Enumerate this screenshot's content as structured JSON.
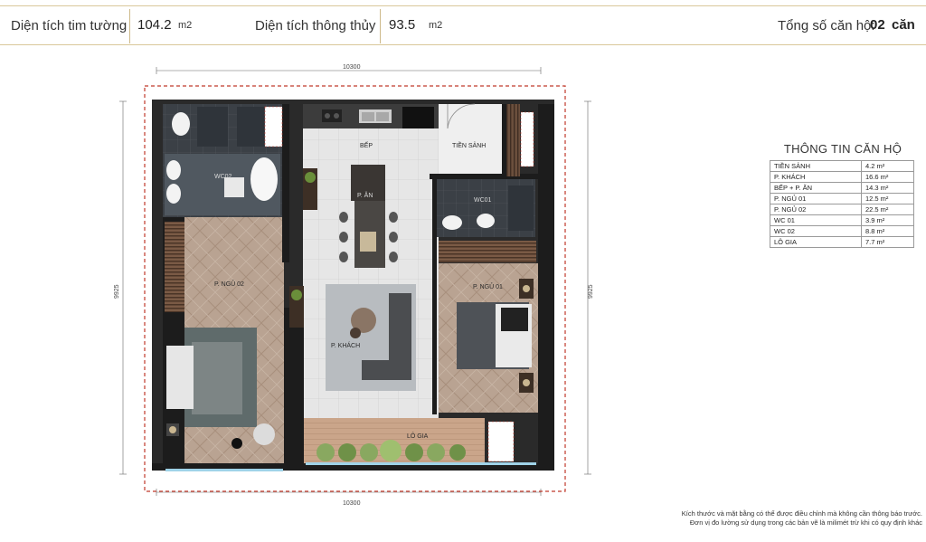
{
  "header": {
    "wall_area_label": "Diện tích tim tường",
    "wall_area_value": "104.2",
    "wall_area_unit": "m2",
    "clear_area_label": "Diện tích thông thủy",
    "clear_area_value": "93.5",
    "clear_area_unit": "m2",
    "unit_count_label": "Tổng số căn hộ:",
    "unit_count_value": "02",
    "unit_count_unit": "căn"
  },
  "plan": {
    "dim_top": "10300",
    "dim_bottom": "10300",
    "dim_left": "9925",
    "dim_right": "9925",
    "rooms": {
      "kitchen": "BẾP",
      "foyer": "TIỀN SẢNH",
      "wc02": "WC02",
      "wc01": "WC01",
      "dining": "P. ĂN",
      "bed02": "P. NGỦ 02",
      "bed01": "P. NGỦ 01",
      "living": "P. KHÁCH",
      "loggia": "LÔ GIA"
    }
  },
  "info": {
    "title": "THÔNG TIN CĂN HỘ",
    "rows": [
      {
        "name": "TIỀN SẢNH",
        "area": "4.2 m²"
      },
      {
        "name": "P. KHÁCH",
        "area": "16.6 m²"
      },
      {
        "name": "BẾP + P. ĂN",
        "area": "14.3 m²"
      },
      {
        "name": "P. NGỦ 01",
        "area": "12.5 m²"
      },
      {
        "name": "P. NGỦ 02",
        "area": "22.5 m²"
      },
      {
        "name": "WC 01",
        "area": "3.9 m²"
      },
      {
        "name": "WC 02",
        "area": "8.8 m²"
      },
      {
        "name": "LÔ GIA",
        "area": "7.7 m²"
      }
    ]
  },
  "footnote": {
    "line1": "Kích thước và mặt bằng có thể được điều chỉnh mà không cần thông báo trước.",
    "line2": "Đơn vị đo lường sử dụng trong các bản vẽ là milimét trừ khi có quy định khác"
  },
  "colors": {
    "gold_rule": "#d9c89a",
    "wall": "#1c1c1c",
    "red_dash": "#c0392b",
    "wood_floor": "#b7a08e",
    "tile_floor": "#e4e4e4",
    "dark_tile": "#3a3f44"
  }
}
